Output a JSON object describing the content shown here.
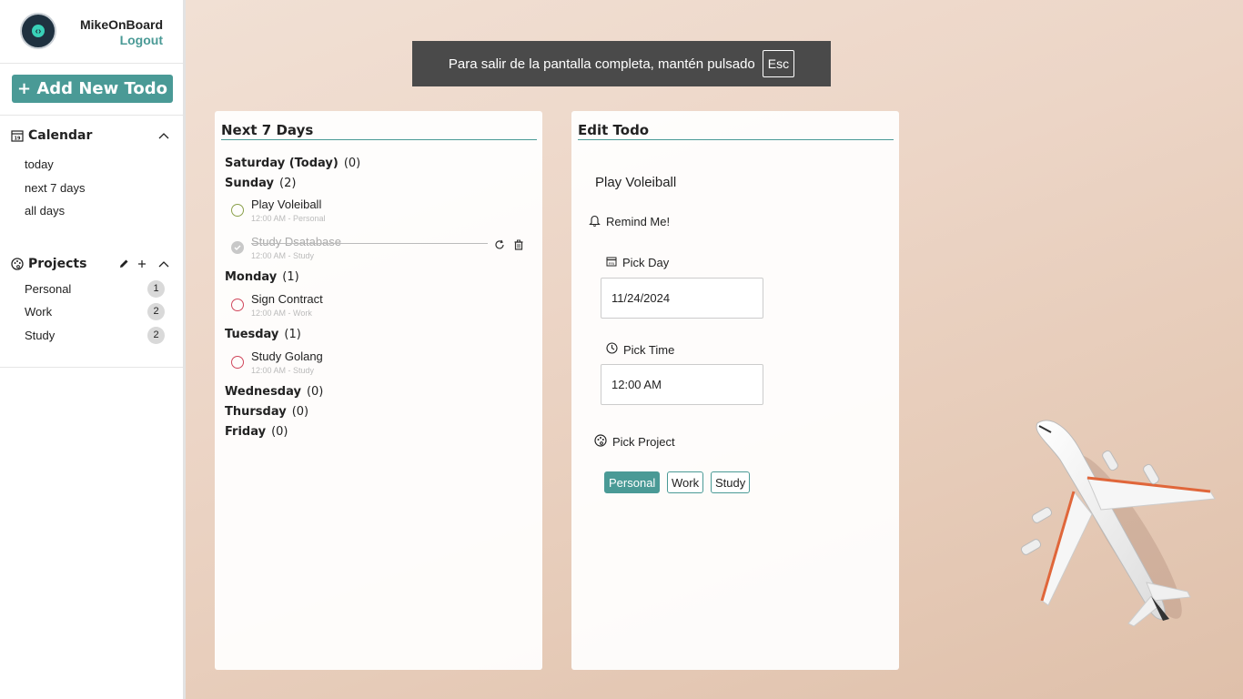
{
  "user": {
    "name": "MikeOnBoard",
    "logout_label": "Logout"
  },
  "sidebar": {
    "add_button_label": "+ Add New Todo",
    "calendar": {
      "title": "Calendar",
      "items": [
        "today",
        "next 7 days",
        "all days"
      ]
    },
    "projects": {
      "title": "Projects",
      "items": [
        {
          "name": "Personal",
          "count": "1"
        },
        {
          "name": "Work",
          "count": "2"
        },
        {
          "name": "Study",
          "count": "2"
        }
      ]
    }
  },
  "fullscreen_notice": {
    "text": "Para salir de la pantalla completa, mantén pulsado",
    "key": "Esc"
  },
  "next7": {
    "title": "Next 7 Days",
    "days": [
      {
        "name": "Saturday (Today)",
        "count": "(0)"
      },
      {
        "name": "Sunday",
        "count": "(2)"
      },
      {
        "name": "Monday",
        "count": "(1)"
      },
      {
        "name": "Tuesday",
        "count": "(1)"
      },
      {
        "name": "Wednesday",
        "count": "(0)"
      },
      {
        "name": "Thursday",
        "count": "(0)"
      },
      {
        "name": "Friday",
        "count": "(0)"
      }
    ],
    "todos": [
      {
        "name": "Play Voleiball",
        "meta": "12:00 AM - Personal",
        "done": false,
        "color": "#8aa04a"
      },
      {
        "name": "Study Dsatabase",
        "meta": "12:00 AM - Study",
        "done": true,
        "color": "#c8c8c8"
      },
      {
        "name": "Sign Contract",
        "meta": "12:00 AM - Work",
        "done": false,
        "color": "#d0455a"
      },
      {
        "name": "Study Golang",
        "meta": "12:00 AM - Study",
        "done": false,
        "color": "#d0455a"
      }
    ]
  },
  "edit": {
    "title": "Edit Todo",
    "todo_name": "Play Voleiball",
    "remind_label": "Remind Me!",
    "pick_day_label": "Pick Day",
    "day_value": "11/24/2024",
    "pick_time_label": "Pick Time",
    "time_value": "12:00 AM",
    "pick_project_label": "Pick Project",
    "projects": [
      "Personal",
      "Work",
      "Study"
    ],
    "selected_project": "Personal"
  },
  "colors": {
    "accent": "#4a9a96"
  }
}
